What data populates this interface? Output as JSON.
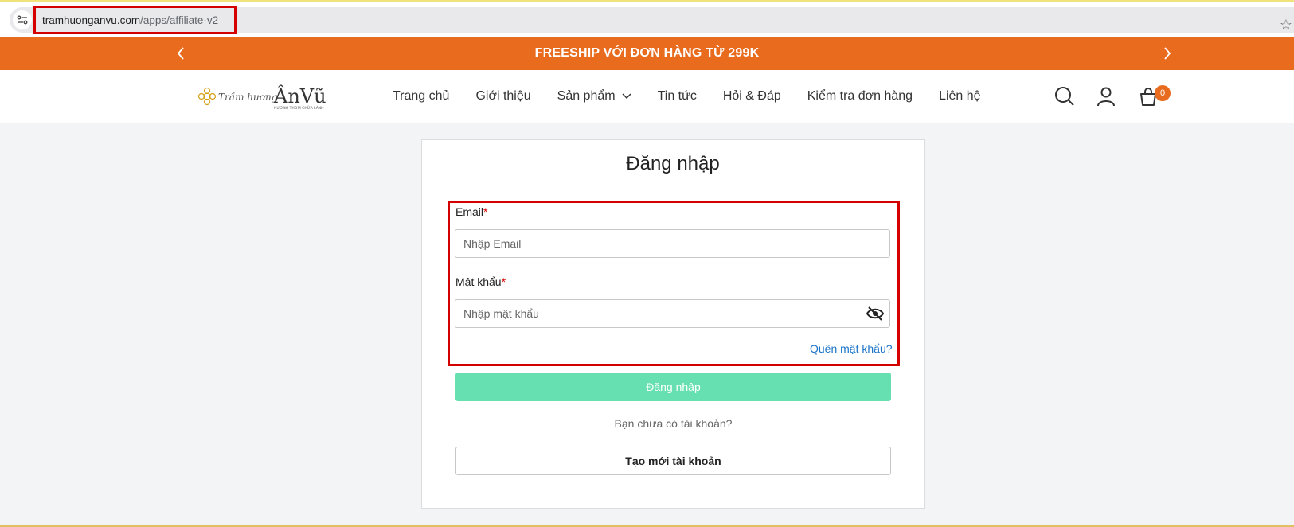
{
  "browser": {
    "url_domain": "tramhuonganvu.com",
    "url_path": "/apps/affiliate-v2"
  },
  "promo": {
    "text": "FREESHIP VỚI ĐƠN HÀNG TỪ 299K"
  },
  "header": {
    "logo_text_script": "Trầm hương",
    "logo_text_brand": "ÂnVũ",
    "logo_tagline": "HƯƠNG THƠM CHỮA LÀNH",
    "nav": [
      {
        "label": "Trang chủ"
      },
      {
        "label": "Giới thiệu"
      },
      {
        "label": "Sản phẩm"
      },
      {
        "label": "Tin tức"
      },
      {
        "label": "Hỏi & Đáp"
      },
      {
        "label": "Kiểm tra đơn hàng"
      },
      {
        "label": "Liên hệ"
      }
    ],
    "cart_count": "0"
  },
  "login": {
    "title": "Đăng nhập",
    "email_label": "Email",
    "email_placeholder": "Nhập Email",
    "password_label": "Mật khẩu",
    "password_placeholder": "Nhập mật khẩu",
    "required_mark": "*",
    "forgot_label": "Quên mật khẩu?",
    "submit_label": "Đăng nhập",
    "no_account_text": "Bạn chưa có tài khoản?",
    "create_label": "Tạo mới tài khoản"
  },
  "colors": {
    "accent_orange": "#e86b1e",
    "login_button": "#66e0b0",
    "highlight_red": "#d40000",
    "link_blue": "#1a73c8"
  }
}
